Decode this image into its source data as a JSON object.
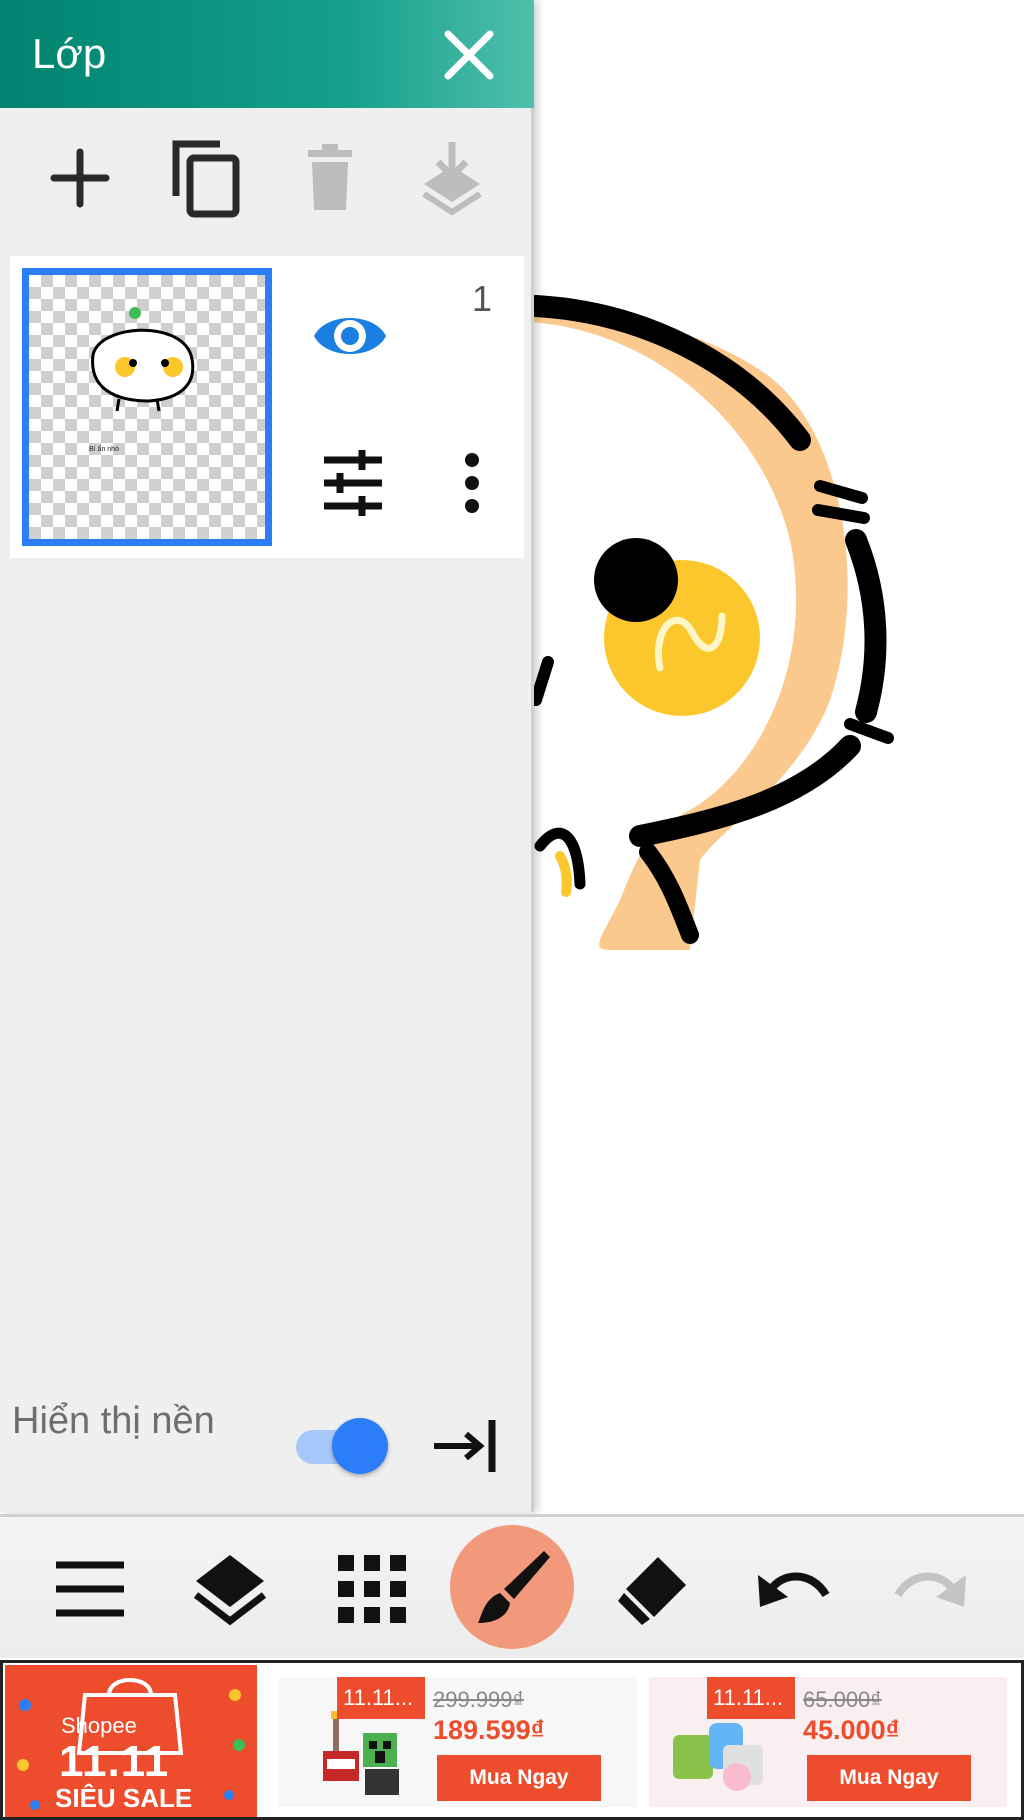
{
  "layer_panel": {
    "title": "Lớp",
    "layer": {
      "number": "1"
    },
    "background_label": "Hiển thị nền",
    "background_visible": true
  },
  "toolbar": {
    "active_tool": "brush",
    "accent_color": "#f2987b"
  },
  "ad": {
    "brand": "Shopee",
    "campaign": "11.11",
    "sale_label": "SIÊU SALE",
    "products": [
      {
        "tag": "11.11...",
        "old_price": "299.999₫",
        "new_price": "189.599₫",
        "button": "Mua Ngay"
      },
      {
        "tag": "11.11...",
        "old_price": "65.000₫",
        "new_price": "45.000₫",
        "button": "Mua Ngay"
      }
    ]
  },
  "colors": {
    "header": "#00836f",
    "selection": "#2c7ef8",
    "ad_red": "#ee4d2d"
  }
}
